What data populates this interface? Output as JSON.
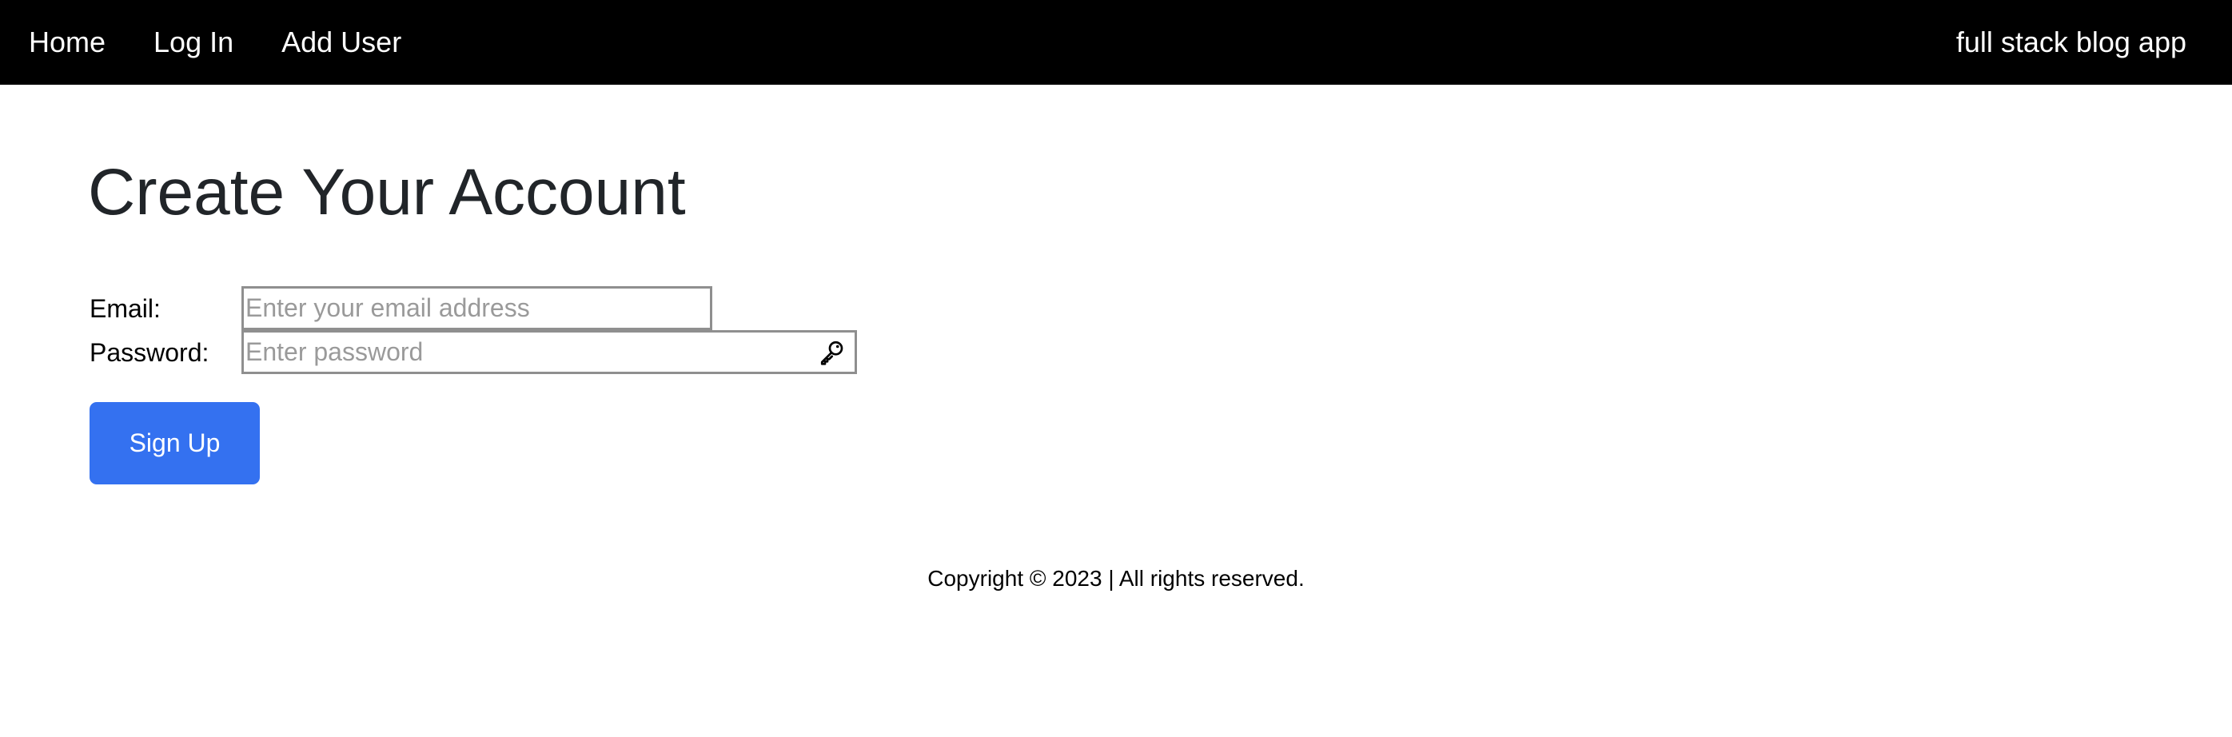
{
  "navbar": {
    "links": [
      {
        "label": "Home"
      },
      {
        "label": "Log In"
      },
      {
        "label": "Add User"
      }
    ],
    "brand": "full stack blog app",
    "background": "#000000"
  },
  "main": {
    "title": "Create Your Account",
    "form": {
      "email": {
        "label": "Email:",
        "value": "",
        "placeholder": "Enter your email address"
      },
      "password": {
        "label": "Password:",
        "value": "",
        "placeholder": "Enter password",
        "icon": "key-icon"
      },
      "submit_label": "Sign Up",
      "submit_color": "#3471f0"
    }
  },
  "footer": {
    "text": "Copyright © 2023 | All rights reserved."
  }
}
